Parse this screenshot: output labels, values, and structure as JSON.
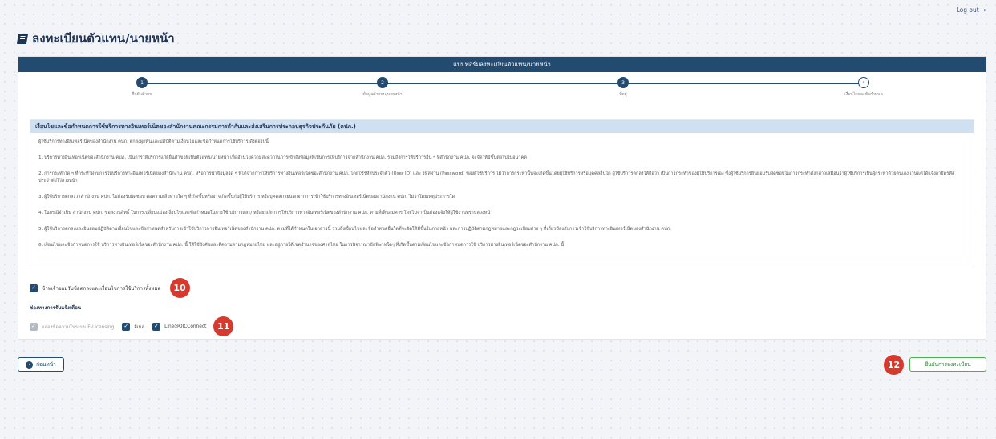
{
  "header": {
    "logout_label": "Log out",
    "title": "ลงทะเบียนตัวแทน/นายหน้า"
  },
  "panel": {
    "title": "แบบฟอร์มลงทะเบียนตัวแทน/นายหน้า"
  },
  "stepper": {
    "steps": [
      {
        "num": "1",
        "label": "ยืนยันตัวตน"
      },
      {
        "num": "2",
        "label": "ข้อมูลตัวแทน/นายหน้า"
      },
      {
        "num": "3",
        "label": "ที่อยู่"
      },
      {
        "num": "4",
        "label": "เงื่อนไขและข้อกำหนด"
      }
    ]
  },
  "terms": {
    "title": "เงื่อนไขและข้อกำหนดการใช้บริการทางอินเทอร์เน็ตของสำนักงานคณะกรรมการกำกับและส่งเสริมการประกอบธุรกิจประกันภัย (คปภ.)",
    "intro": "ผู้ใช้บริการทางอินเทอร์เน็ตของสำนักงาน คปภ. ตกลงผูกพันและปฏิบัติตามเงื่อนไขและข้อกำหนดการใช้บริการ ดังต่อไปนี้",
    "items": [
      "1. บริการทางอินเทอร์เน็ตของสำนักงาน คปภ. เป็นการให้บริการแก่ผู้ยื่นคำขอที่เป็นตัวแทน/นายหน้า เพื่ออำนวยความสะดวกในการเข้าถึงข้อมูลที่เป็นการให้บริการจากสำนักงาน คปภ. รวมถึงการให้บริการอื่น ๆ ที่สำนักงาน คปภ. จะจัดให้มีขึ้นต่อไปในอนาคต",
      "2. การกระทำใด ๆ ที่กระทำผ่านการให้บริการทางอินเทอร์เน็ตของสำนักงาน คปภ. หรือการนำข้อมูลใด ๆ ที่ได้จากการให้บริการทางอินเทอร์เน็ตของสำนักงาน คปภ. โดยใช้รหัสประจำตัว (User ID) และ รหัสผ่าน (Password) ของผู้ใช้บริการ ไม่ว่าการกระทำนั้นจะเกิดขึ้นโดยผู้ใช้บริการหรือบุคคลอื่นใด ผู้ใช้บริการตกลงให้ถือว่า เป็นการกระทำของผู้ใช้บริการเอง ซึ่งผู้ใช้บริการยินยอมรับผิดชอบในการกระทำดังกล่าวเสมือนว่าผู้ใช้บริการเป็นผู้กระทำด้วยตนเอง เว้นแต่ได้แจ้งอายัดรหัสประจำตัวไว้ล่วงหน้า",
      "3. ผู้ใช้บริการตกลงว่าสำนักงาน คปภ. ไม่ต้องรับผิดชอบ ต่อความเสียหายใด ๆ ที่เกิดขึ้นหรืออาจเกิดขึ้นกับผู้ใช้บริการ หรือบุคคลภายนอกจากการเข้าใช้บริการทางอินเทอร์เน็ตของสำนักงาน คปภ. ไม่ว่าโดยเหตุประการใด",
      "4. ในกรณีจำเป็น สำนักงาน คปภ. ขอสงวนสิทธิ์ ในการเปลี่ยนแปลงเงื่อนไขและข้อกำหนดในการใช้ บริการและ/ หรือยกเลิกการให้บริการทางอินเทอร์เน็ตของสำนักงาน คปภ. ตามที่เห็นสมควร โดยไม่จำเป็นต้องแจ้งให้ผู้ใช้งานทราบล่วงหน้า",
      "5. ผู้ใช้บริการตกลงและยินยอมปฏิบัติตามเงื่อนไขและข้อกำหนดสำหรับการเข้าใช้บริการทางอินเทอร์เน็ตของสำนักงาน คปภ. ตามที่ได้กำหนดในเอกสารนี้ รวมถึงเงื่อนไขและข้อกำหนดอื่นใดที่จะจัดให้มีขึ้นในภายหน้า และการปฏิบัติตามกฎหมายและกฎระเบียบต่าง ๆ ที่เกี่ยวข้องกับการเข้าใช้บริการทางอินเทอร์เน็ตของสำนักงาน คปภ.",
      "6. เงื่อนไขและข้อกำหนดการใช้ บริการทางอินเทอร์เน็ตของสำนักงาน คปภ. นี้ ให้ใช้บังคับและตีความตามกฎหมายไทย และอยู่ภายใต้เขตอำนาจของศาลไทย ในการพิจารณาข้อพิพาทใดๆ ที่เกิดขึ้นตามเงื่อนไขและข้อกำหนดการใช้ บริการทางอินเทอร์เน็ตของสำนักงาน คปภ. นี้"
    ]
  },
  "agree": {
    "label": "ข้าพเจ้ายอมรับข้อตกลงและเงื่อนไขการใช้บริการทั้งหมด",
    "checked": true,
    "badge": "10"
  },
  "notify": {
    "title": "ช่องทางการรับแจ้งเตือน",
    "options": [
      {
        "label": "กล่องข้อความในระบบ E-Licensing",
        "checked": true,
        "disabled": true
      },
      {
        "label": "อีเมล",
        "checked": true
      },
      {
        "label": "Line@OICConnect",
        "checked": true
      }
    ],
    "badge": "11"
  },
  "footer": {
    "back_label": "ก่อนหน้า",
    "confirm_label": "ยืนยันการลงทะเบียน",
    "badge": "12"
  }
}
